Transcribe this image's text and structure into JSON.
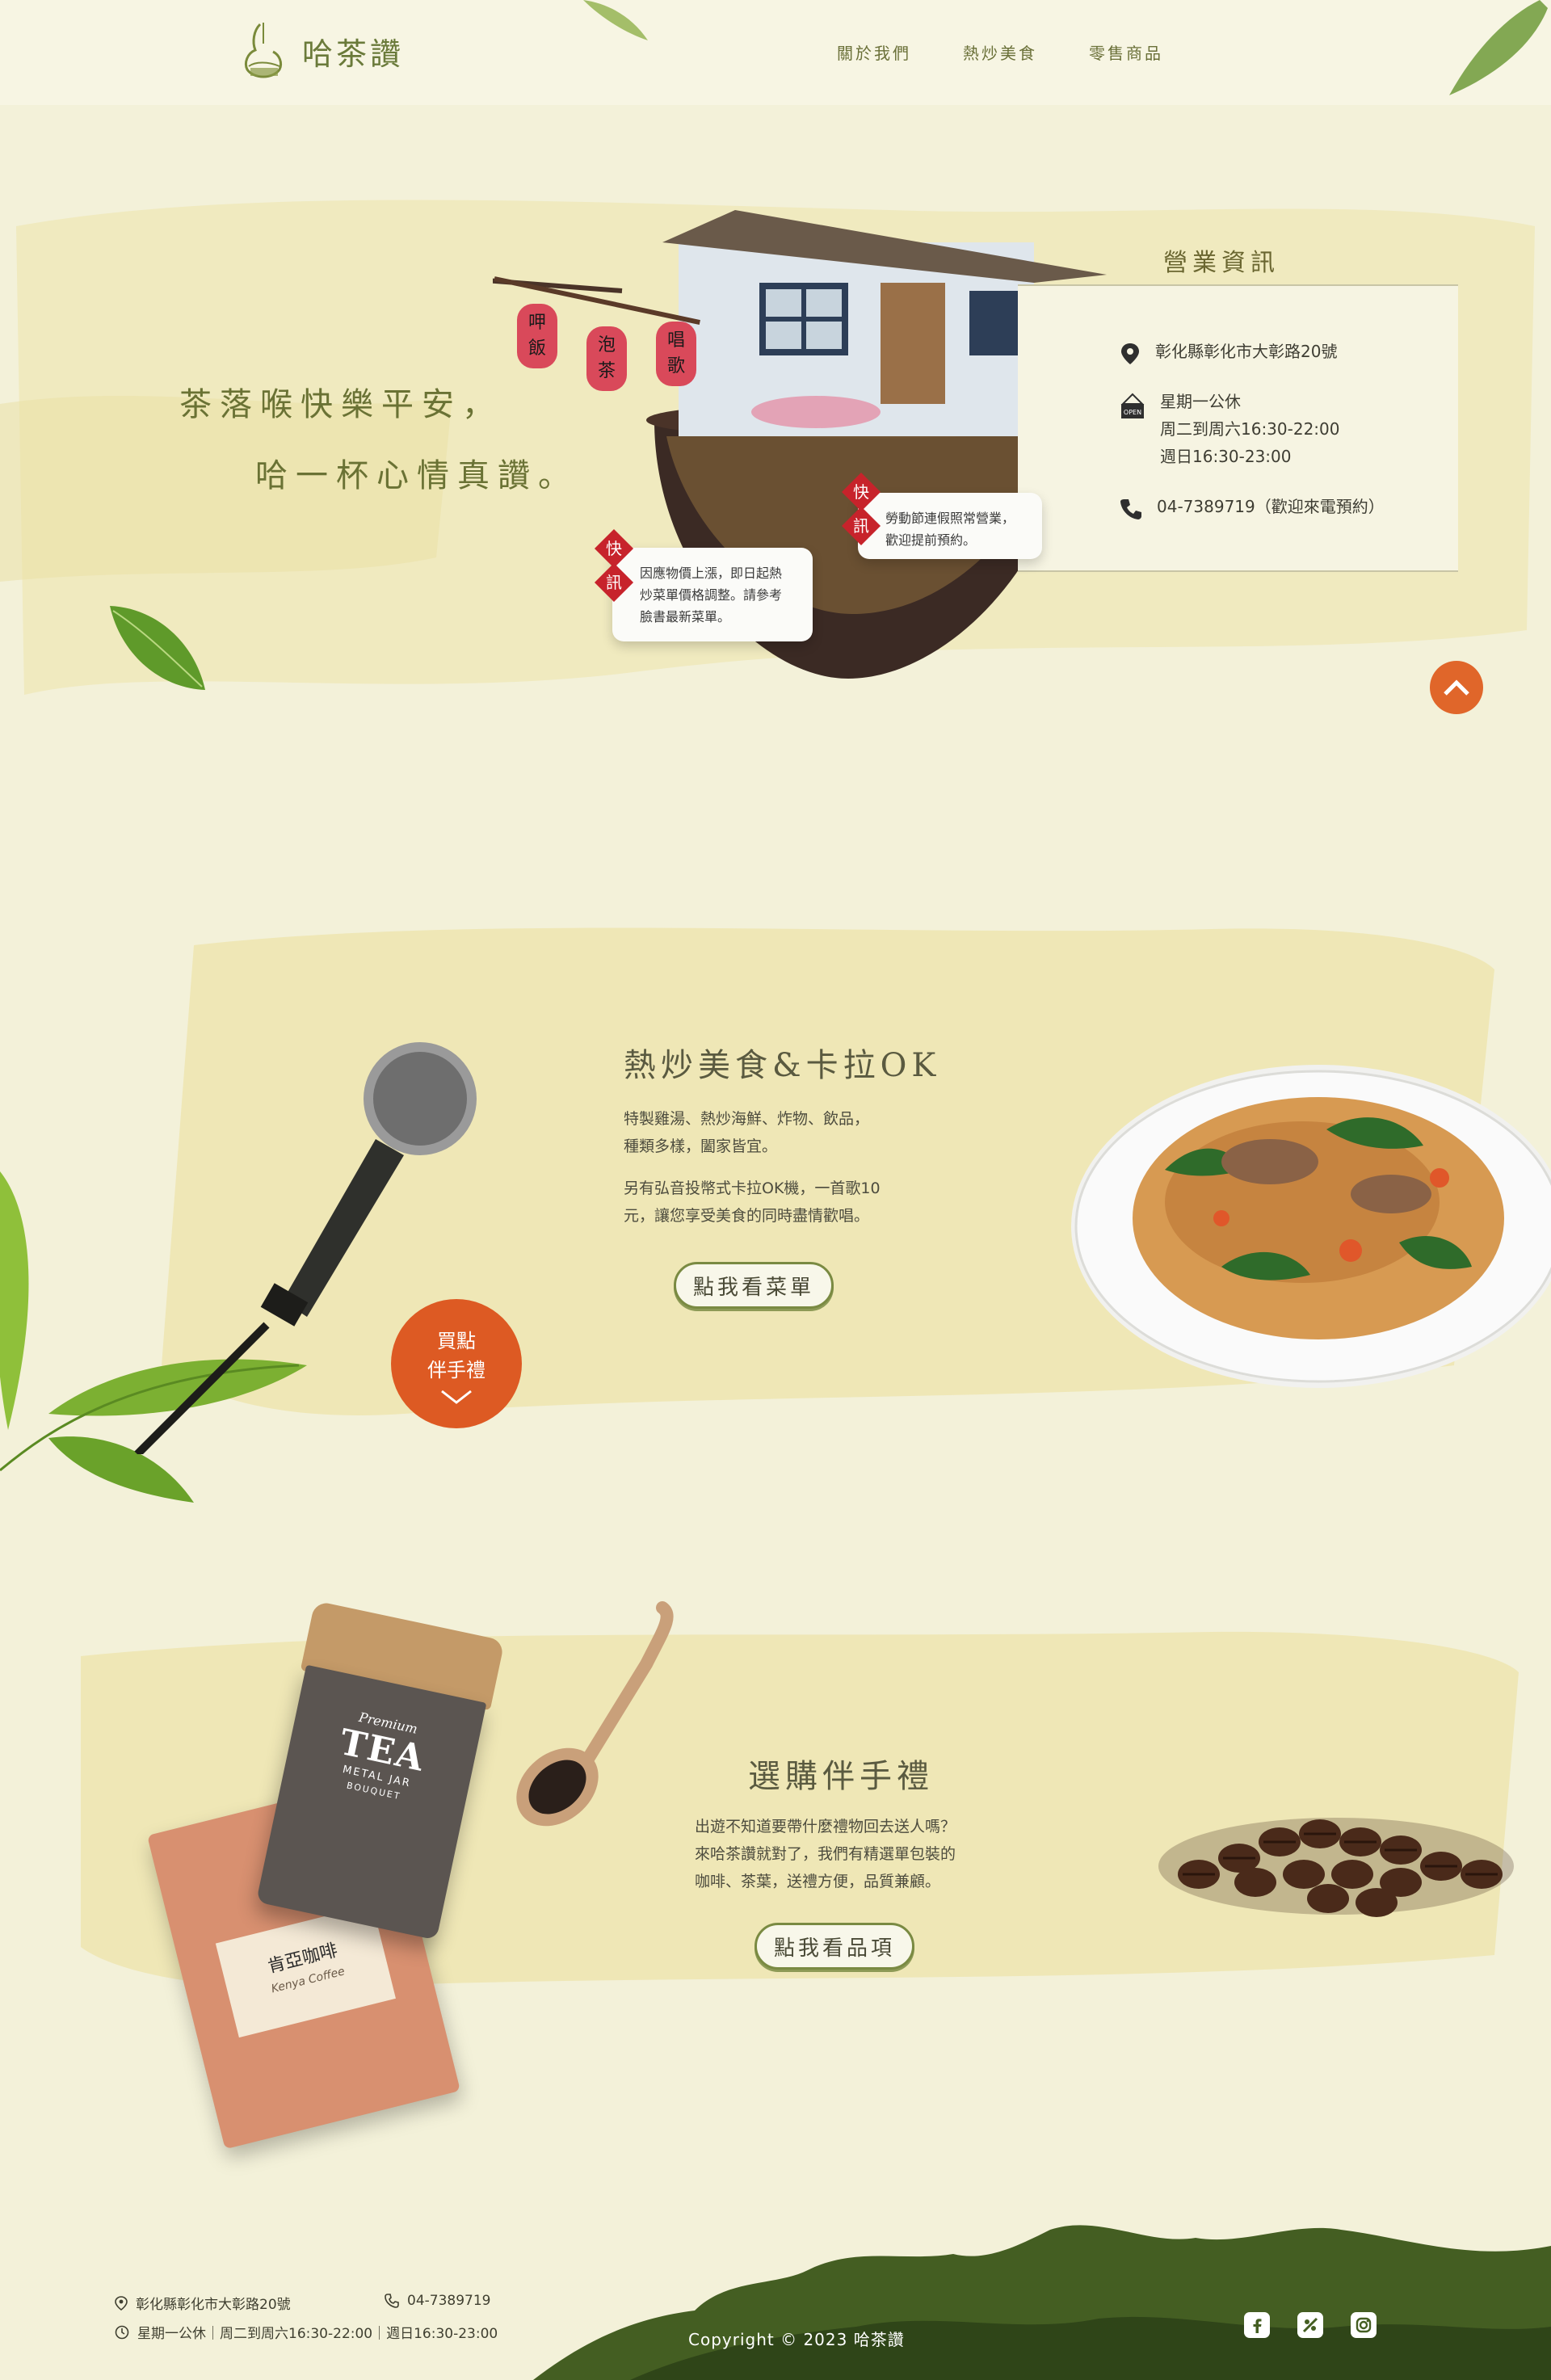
{
  "header": {
    "brand": "哈茶讚",
    "nav": [
      "關於我們",
      "熱炒美食",
      "零售商品"
    ]
  },
  "hero": {
    "line1": "茶落喉快樂平安，",
    "line2": "哈一杯心情真讚。",
    "lanterns": [
      "呷飯",
      "泡茶",
      "唱歌"
    ],
    "news": [
      {
        "tag": [
          "快",
          "訊"
        ],
        "text": [
          "因應物價上漲，即日起熱",
          "炒菜單價格調整。請參考",
          "臉書最新菜單。"
        ]
      },
      {
        "tag": [
          "快",
          "訊"
        ],
        "text": [
          "勞動節連假照常營業，",
          "歡迎提前預約。"
        ]
      }
    ]
  },
  "business_info": {
    "title": "營業資訊",
    "address": "彰化縣彰化市大彰路20號",
    "hours": [
      "星期一公休",
      "周二到周六16:30-22:00",
      "週日16:30-23:00"
    ],
    "phone": "04-7389719（歡迎來電預約）",
    "open_sign": "OPEN"
  },
  "stir_fry": {
    "title": "熱炒美食&卡拉OK",
    "text1": [
      "特製雞湯、熱炒海鮮、炸物、飲品，",
      "種類多樣，闔家皆宜。"
    ],
    "text2": [
      "另有弘音投幣式卡拉OK機，一首歌10",
      "元，讓您享受美食的同時盡情歡唱。"
    ],
    "button": "點我看菜單",
    "badge": [
      "買點",
      "伴手禮"
    ]
  },
  "gifts": {
    "title": "選購伴手禮",
    "text": [
      "出遊不知道要帶什麼禮物回去送人嗎？",
      "來哈茶讚就對了，我們有精選單包裝的",
      "咖啡、茶葉，送禮方便，品質兼顧。"
    ],
    "button": "點我看品項",
    "tin_text": [
      "Premium",
      "TEA",
      "METAL JAR",
      "BOUQUET"
    ],
    "bag_text": [
      "肯亞咖啡",
      "Kenya Coffee"
    ]
  },
  "footer": {
    "address": "彰化縣彰化市大彰路20號",
    "phone": "04-7389719",
    "hours": "星期一公休｜周二到周六16:30-22:00｜週日16:30-23:00",
    "copyright": "Copyright © 2023 哈茶讚"
  },
  "colors": {
    "background": "#f3f1d9",
    "accent_orange": "#e0662a",
    "news_red": "#c7232b",
    "olive": "#6a7234",
    "mountain_green": "#3f5a1e"
  }
}
